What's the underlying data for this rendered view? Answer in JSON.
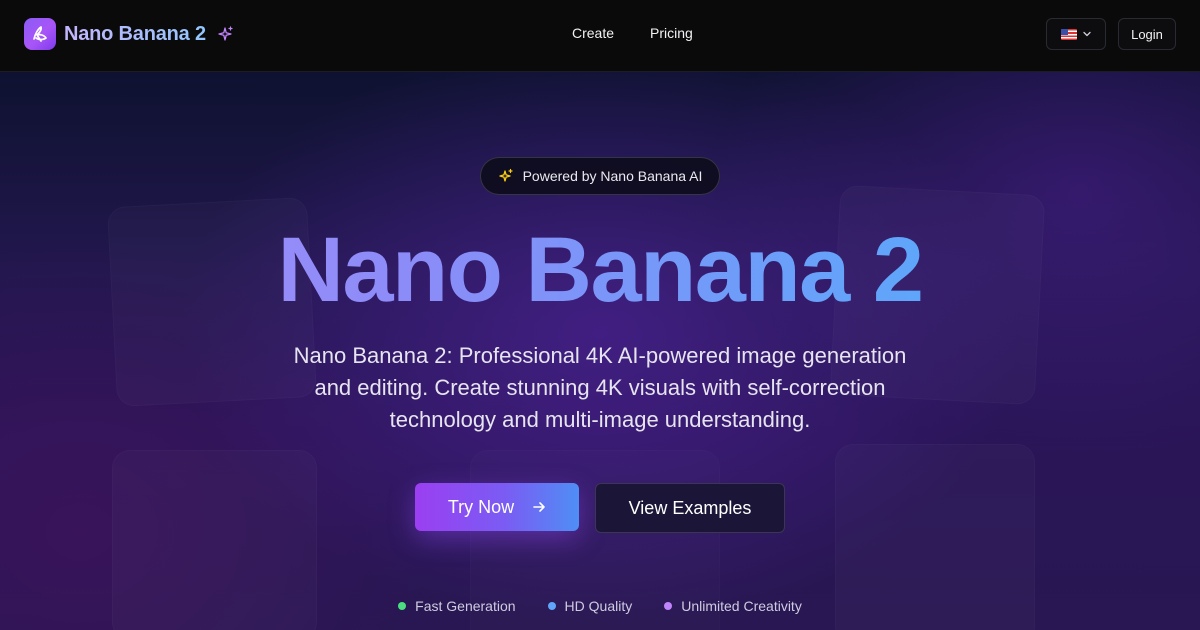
{
  "nav": {
    "brand_name": "Nano Banana 2",
    "links": [
      {
        "label": "Create"
      },
      {
        "label": "Pricing"
      }
    ],
    "language_icon": "us-flag-icon",
    "login_label": "Login"
  },
  "hero": {
    "badge_text": "Powered by Nano Banana AI",
    "headline": "Nano Banana 2",
    "subtitle": "Nano Banana 2: Professional 4K AI-powered image generation and editing. Create stunning 4K visuals with self-correction technology and multi-image understanding.",
    "try_button_label": "Try Now",
    "examples_button_label": "View Examples",
    "features": [
      {
        "label": "Fast Generation",
        "color": "#4ade80"
      },
      {
        "label": "HD Quality",
        "color": "#60a5fa"
      },
      {
        "label": "Unlimited Creativity",
        "color": "#c084fc"
      }
    ]
  },
  "colors": {
    "accent_purple": "#9b3ff2",
    "accent_blue": "#4f8ef5",
    "nav_bg": "#0a0a0a"
  }
}
